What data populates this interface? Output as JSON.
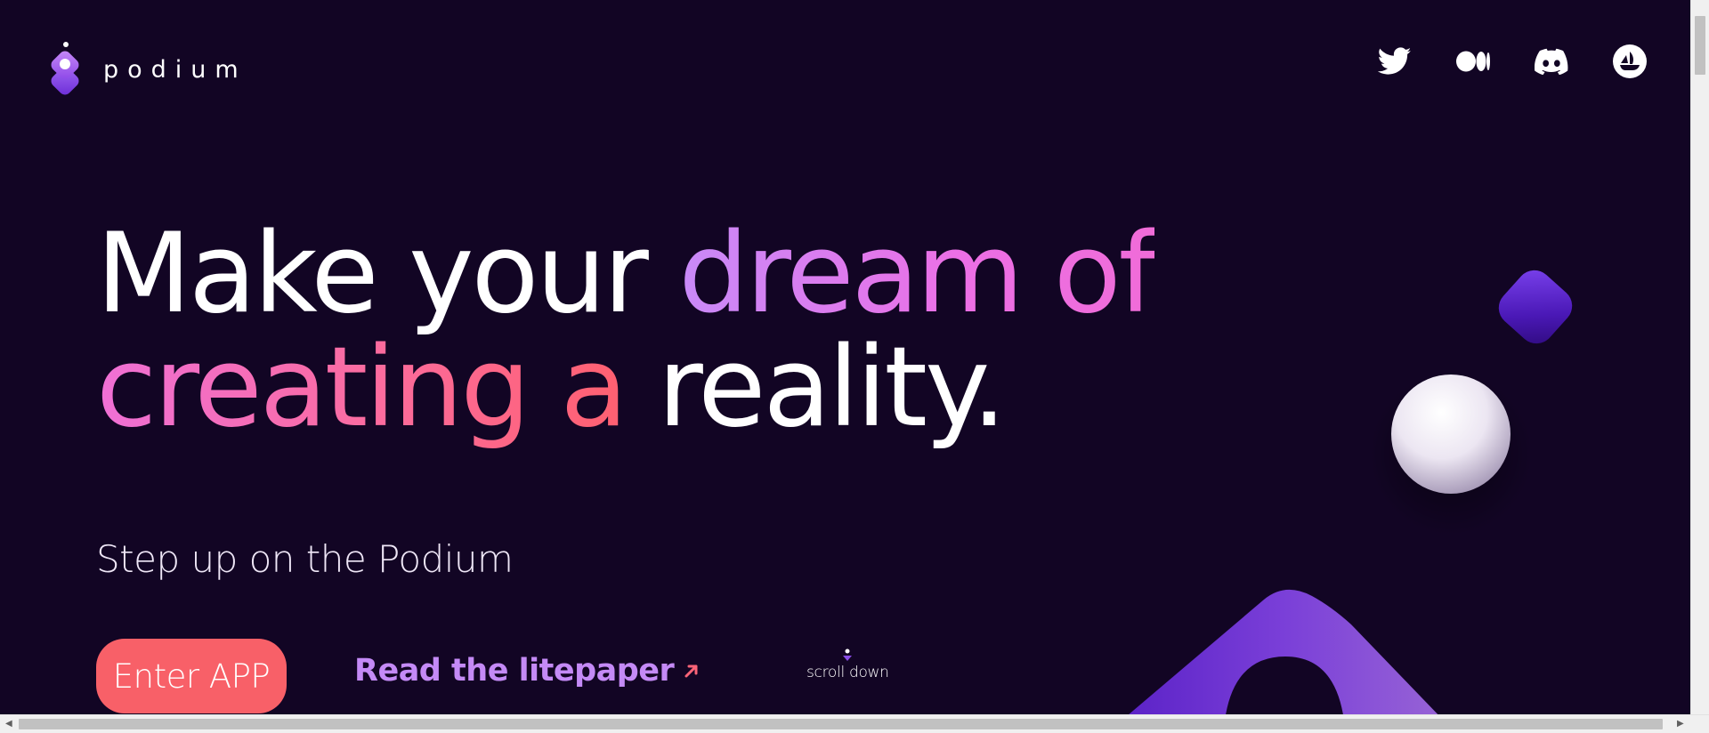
{
  "brand": {
    "name": "podium",
    "icon": "podium-cube-logo-icon"
  },
  "socials": [
    {
      "name": "twitter",
      "icon": "twitter-icon"
    },
    {
      "name": "medium",
      "icon": "medium-icon"
    },
    {
      "name": "discord",
      "icon": "discord-icon"
    },
    {
      "name": "opensea",
      "icon": "opensea-icon"
    }
  ],
  "hero": {
    "headline": {
      "part1": "Make your ",
      "part2": "dream of",
      "part3": "creating a",
      "part4": " reality."
    },
    "subtitle": "Step up on the Podium",
    "enter_button": "Enter APP",
    "litepaper_link": "Read the litepaper",
    "litepaper_icon": "arrow-up-right-icon",
    "scroll_label": "scroll down",
    "scroll_icon": "scroll-down-icon"
  },
  "colors": {
    "background": "#120524",
    "accent_button": "#f86068",
    "accent_link": "#c48af6",
    "gradient_pink": "#ec6fe5",
    "gradient_coral": "#ff6070"
  }
}
